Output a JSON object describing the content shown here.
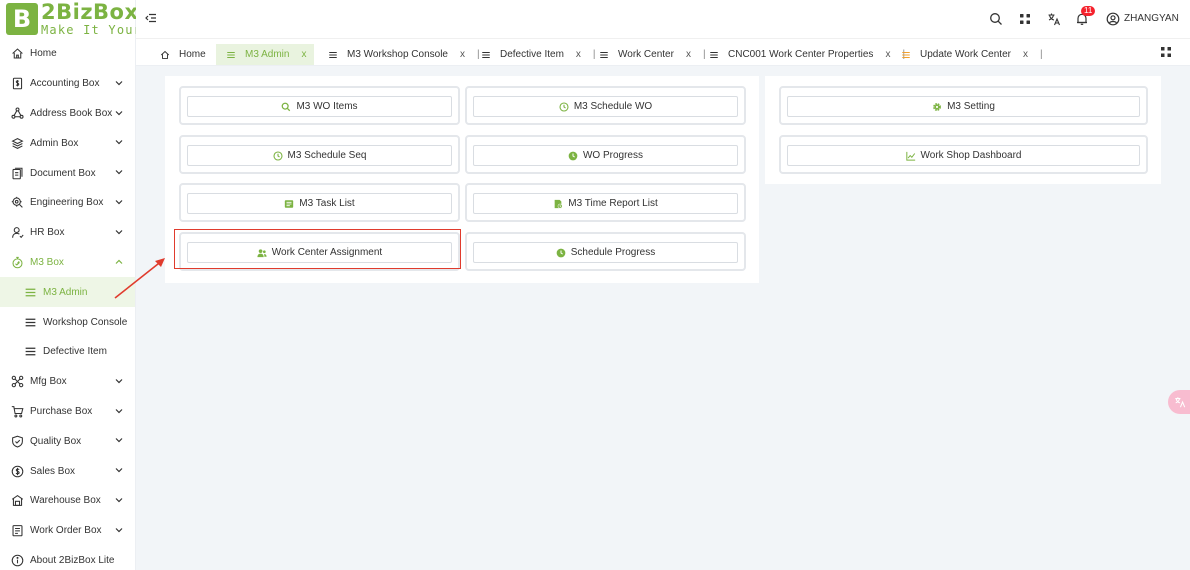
{
  "brand": {
    "mark": "B",
    "name": "2BizBox",
    "tagline": "Make It Yours"
  },
  "sidebar": {
    "items": [
      {
        "label": "Home",
        "icon": "home-icon"
      },
      {
        "label": "Accounting Box",
        "icon": "dollar-doc-icon"
      },
      {
        "label": "Address Book Box",
        "icon": "triangle-nodes-icon"
      },
      {
        "label": "Admin Box",
        "icon": "layers-icon"
      },
      {
        "label": "Document Box",
        "icon": "document-icon"
      },
      {
        "label": "Engineering Box",
        "icon": "gear-search-icon"
      },
      {
        "label": "HR Box",
        "icon": "person-icon"
      },
      {
        "label": "M3 Box",
        "icon": "timer-icon"
      },
      {
        "label": "M3 Admin",
        "icon": "menu-lines-icon"
      },
      {
        "label": "Workshop Console",
        "icon": "menu-lines-icon"
      },
      {
        "label": "Defective Item",
        "icon": "menu-lines-icon"
      },
      {
        "label": "Mfg Box",
        "icon": "cross-nodes-icon"
      },
      {
        "label": "Purchase Box",
        "icon": "cart-icon"
      },
      {
        "label": "Quality Box",
        "icon": "shield-check-icon"
      },
      {
        "label": "Sales Box",
        "icon": "dollar-circle-icon"
      },
      {
        "label": "Warehouse Box",
        "icon": "warehouse-icon"
      },
      {
        "label": "Work Order Box",
        "icon": "clipboard-icon"
      },
      {
        "label": "About 2BizBox Lite",
        "icon": "info-icon"
      }
    ]
  },
  "topbar": {
    "notification_count": "11",
    "username": "ZHANGYAN"
  },
  "tabs": [
    {
      "label": "Home",
      "close": "",
      "sep": ""
    },
    {
      "label": "M3 Admin",
      "close": "x",
      "sep": ""
    },
    {
      "label": "M3 Workshop Console",
      "close": "x",
      "sep": "|"
    },
    {
      "label": "Defective Item",
      "close": "x",
      "sep": "|"
    },
    {
      "label": "Work Center",
      "close": "x",
      "sep": "|"
    },
    {
      "label": "CNC001 Work Center Properties",
      "close": "x",
      "sep": "|"
    },
    {
      "label": "Update Work Center",
      "close": "x",
      "sep": "|"
    }
  ],
  "left_panel": {
    "buttons": [
      {
        "label": "M3 WO Items",
        "icon": "search-icon"
      },
      {
        "label": "M3 Schedule WO",
        "icon": "clock-icon"
      },
      {
        "label": "M3 Schedule Seq",
        "icon": "clock-icon"
      },
      {
        "label": "WO Progress",
        "icon": "clock-filled-icon"
      },
      {
        "label": "M3 Task List",
        "icon": "list-box-icon"
      },
      {
        "label": "M3 Time Report List",
        "icon": "report-icon"
      },
      {
        "label": "Work Center Assignment",
        "icon": "users-icon"
      },
      {
        "label": "Schedule Progress",
        "icon": "clock-filled-icon"
      }
    ]
  },
  "right_panel": {
    "buttons": [
      {
        "label": "M3 Setting",
        "icon": "gear-icon"
      },
      {
        "label": "Work Shop Dashboard",
        "icon": "line-chart-icon"
      }
    ]
  },
  "colors": {
    "accent": "#7cb342",
    "highlight": "#e03b2d",
    "badge": "#f5222d"
  }
}
